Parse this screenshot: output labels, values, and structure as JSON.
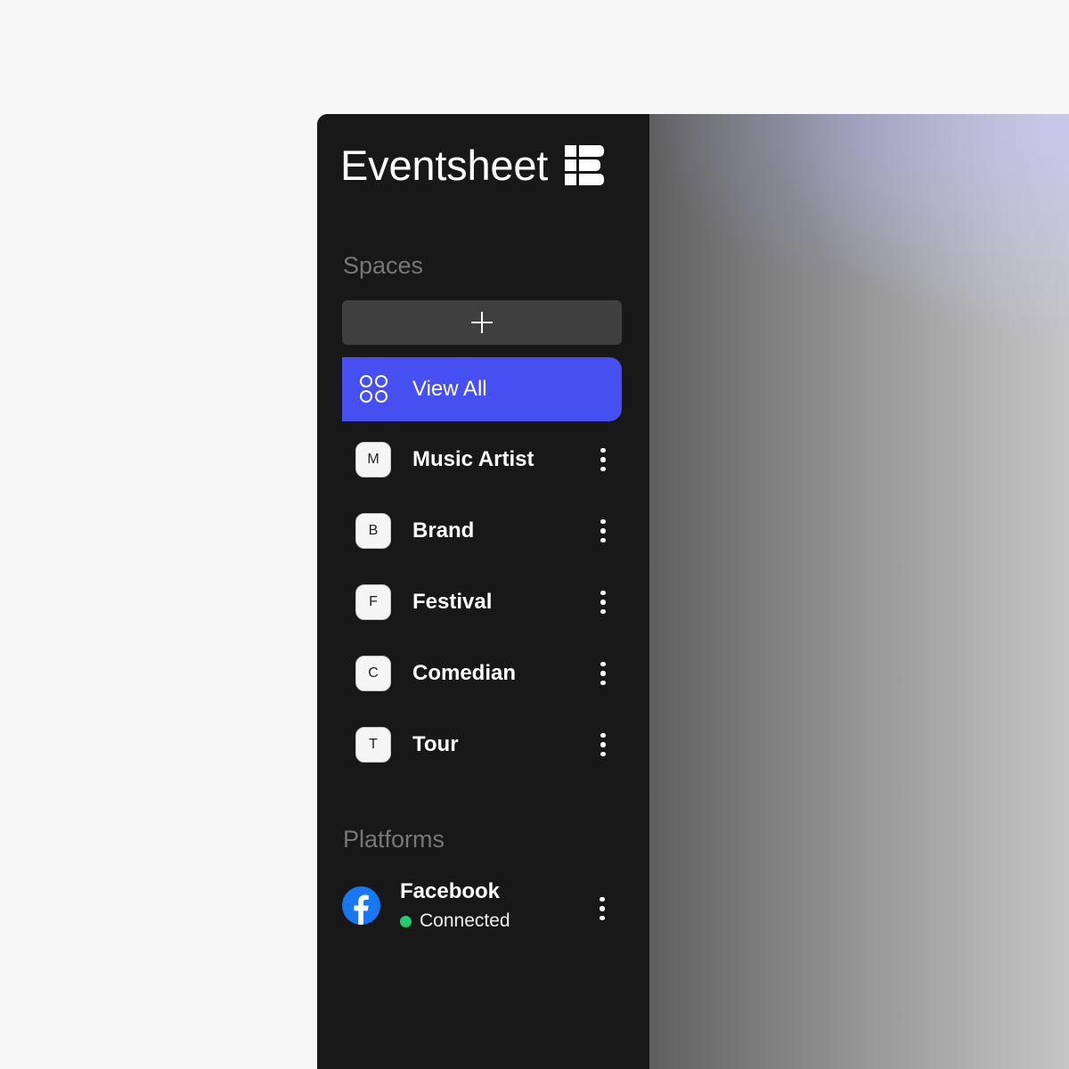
{
  "app": {
    "title": "Eventsheet",
    "logo_icon": "eventsheet-logo-icon"
  },
  "spaces": {
    "label": "Spaces",
    "add_button_icon": "plus-icon",
    "view_all": {
      "label": "View All",
      "icon": "grid-circles-icon",
      "active": true
    },
    "items": [
      {
        "initial": "M",
        "label": "Music Artist"
      },
      {
        "initial": "B",
        "label": "Brand"
      },
      {
        "initial": "F",
        "label": "Festival"
      },
      {
        "initial": "C",
        "label": "Comedian"
      },
      {
        "initial": "T",
        "label": "Tour"
      }
    ]
  },
  "platforms": {
    "label": "Platforms",
    "items": [
      {
        "name": "Facebook",
        "icon": "facebook-icon",
        "status": "Connected",
        "status_color": "#22cc6e"
      }
    ]
  },
  "colors": {
    "accent": "#4650f0",
    "sidebar_bg": "#181818",
    "page_bg": "#f7f7f7"
  }
}
